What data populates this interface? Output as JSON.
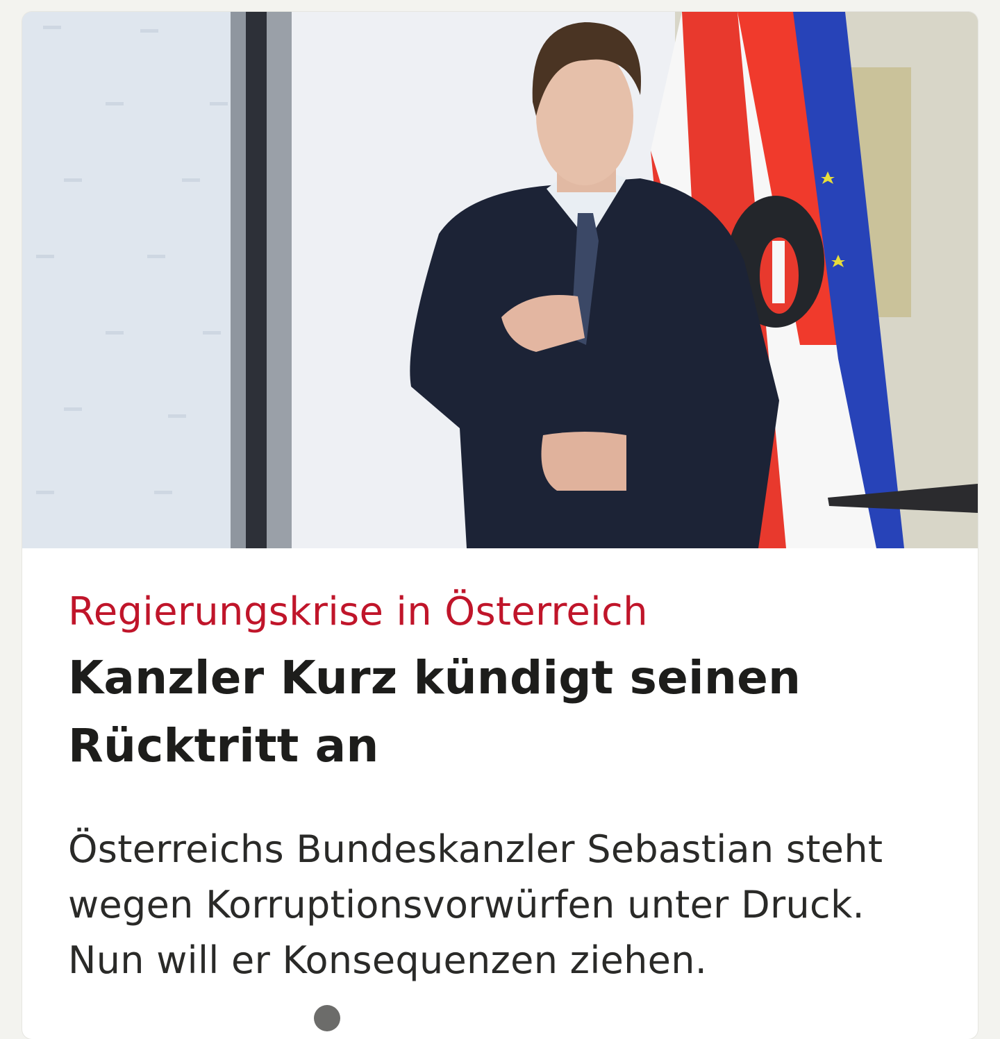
{
  "article": {
    "image_alt": "Sebastian Kurz vor Flaggen",
    "kicker": "Regierungskrise in Österreich",
    "headline": "Kanzler Kurz kündigt seinen Rücktritt an",
    "teaser": "Österreichs Bundeskanzler Sebastian steht wegen Korruptionsvorwürfen unter Druck. Nun will er Konsequenzen ziehen."
  },
  "colors": {
    "kicker": "#c0152a",
    "headline": "#1d1d1b",
    "background": "#f3f3ef",
    "card": "#ffffff"
  }
}
